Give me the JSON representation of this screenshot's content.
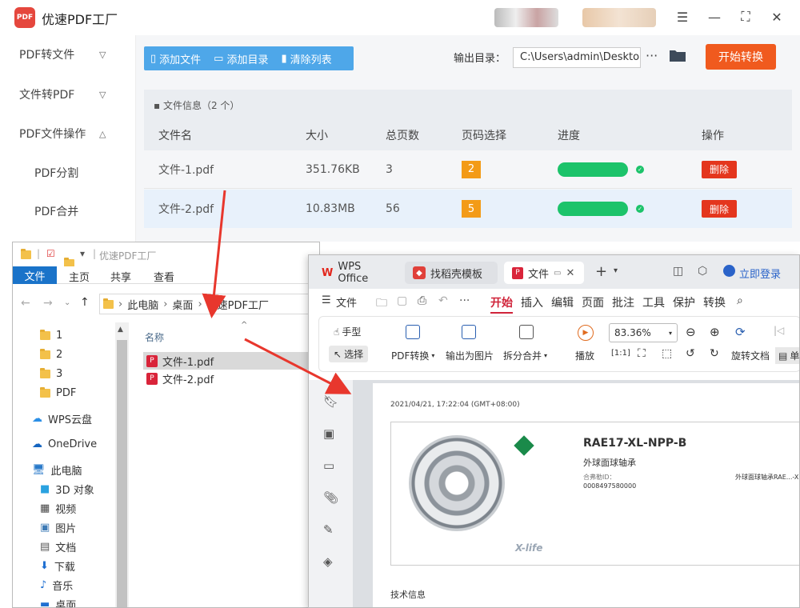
{
  "app": {
    "title": "优速PDF工厂",
    "logo_text": "PDF",
    "window_controls": [
      "menu-icon",
      "fullscreen-icon",
      "close-icon"
    ]
  },
  "sidebar": {
    "items": [
      {
        "label": "PDF转文件",
        "chevron": "⌄"
      },
      {
        "label": "文件转PDF",
        "chevron": "⌄"
      },
      {
        "label": "PDF文件操作",
        "chevron": "⌃"
      },
      {
        "label": "PDF分割"
      },
      {
        "label": "PDF合并"
      }
    ]
  },
  "toolbar": {
    "add_file": "添加文件",
    "add_folder": "添加目录",
    "clear_list": "清除列表"
  },
  "output": {
    "label": "输出目录：",
    "path": "C:\\Users\\admin\\Deskto",
    "more": "···",
    "start": "开始转换"
  },
  "file_info": "文件信息（2 个）",
  "table": {
    "headers": [
      "文件名",
      "大小",
      "总页数",
      "页码选择",
      "进度",
      "操作"
    ],
    "rows": [
      {
        "name": "文件-1.pdf",
        "size": "351.76KB",
        "pages": "3",
        "page_sel": "2",
        "progress": 1.0,
        "action": "删除"
      },
      {
        "name": "文件-2.pdf",
        "size": "10.83MB",
        "pages": "56",
        "page_sel": "5",
        "progress": 1.0,
        "action": "删除"
      }
    ]
  },
  "explorer": {
    "title": "优速PDF工厂",
    "ribbon": [
      "文件",
      "主页",
      "共享",
      "查看"
    ],
    "breadcrumb": [
      "此电脑",
      "桌面",
      "优速PDF工厂"
    ],
    "column_name": "名称",
    "nav": [
      "1",
      "2",
      "3",
      "PDF",
      "WPS云盘",
      "OneDrive",
      "此电脑",
      "3D 对象",
      "视频",
      "图片",
      "文档",
      "下载",
      "音乐",
      "桌面"
    ],
    "files": [
      "文件-1.pdf",
      "文件-2.pdf"
    ]
  },
  "wps": {
    "tabs": [
      "WPS Office",
      "找稻壳模板",
      "文件"
    ],
    "login": "立即登录",
    "menu": [
      "文件",
      "开始",
      "插入",
      "编辑",
      "页面",
      "批注",
      "工具",
      "保护",
      "转换"
    ],
    "ribbon": {
      "hand": "手型",
      "select": "选择",
      "pdf_convert": "PDF转换",
      "export_img": "输出为图片",
      "split_merge": "拆分合并",
      "play": "播放",
      "zoom": "83.36%",
      "rotate": "旋转文档",
      "single": "单"
    },
    "doc": {
      "timestamp": "2021/04/21, 17:22:04 (GMT+08:00)",
      "product": "RAE17-XL-NPP-B",
      "subtitle": "外球面球轴承",
      "id_label": "合弗勒ID：",
      "id": "0008497580000",
      "right_text": "外球面球轴承RAE...-X",
      "xlife": "X-life",
      "tech": "技术信息"
    }
  }
}
